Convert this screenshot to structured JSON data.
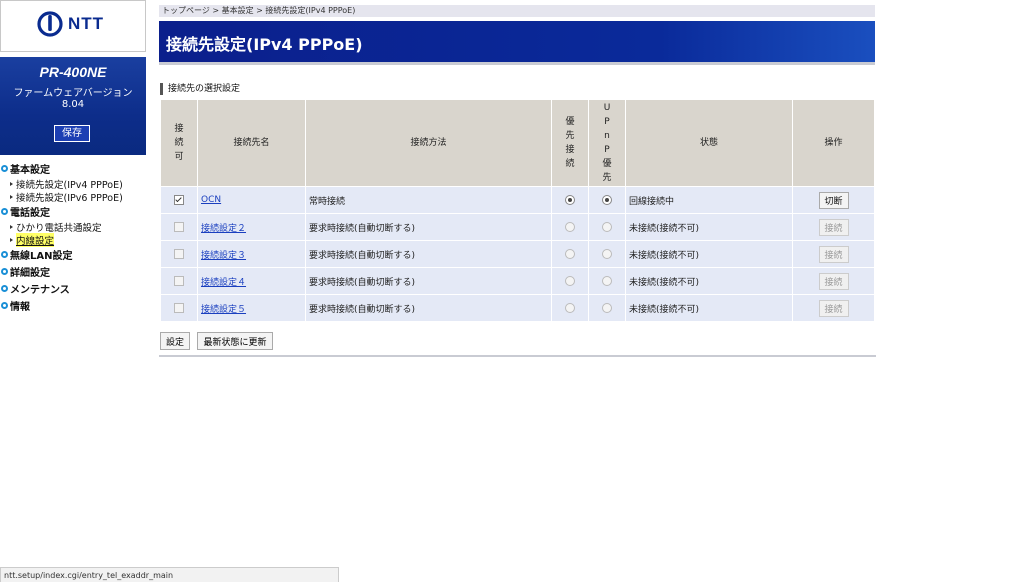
{
  "brand": {
    "logo_text": "NTT"
  },
  "device": {
    "model": "PR-400NE",
    "firmware_label": "ファームウェアバージョン",
    "firmware_version": "8.04",
    "save_label": "保存"
  },
  "nav": {
    "basic": {
      "label": "基本設定",
      "items": [
        "接続先設定(IPv4 PPPoE)",
        "接続先設定(IPv6 PPPoE)"
      ]
    },
    "phone": {
      "label": "電話設定",
      "items": [
        "ひかり電話共通設定",
        "内線設定"
      ]
    },
    "wireless": {
      "label": "無線LAN設定"
    },
    "advanced": {
      "label": "詳細設定"
    },
    "maintenance": {
      "label": "メンテナンス"
    },
    "info": {
      "label": "情報"
    }
  },
  "breadcrumb": "トップページ > 基本設定 > 接続先設定(IPv4 PPPoE)",
  "page": {
    "title": "接続先設定(IPv4 PPPoE)",
    "section_title": "接続先の選択設定"
  },
  "table": {
    "headers": {
      "enable": "接続可",
      "name": "接続先名",
      "method": "接続方法",
      "priority": "優先接続",
      "upnp": "UPnP優先",
      "status": "状態",
      "operation": "操作"
    },
    "rows": [
      {
        "enabled": true,
        "name": "OCN",
        "method": "常時接続",
        "priority": true,
        "upnp": true,
        "status": "回線接続中",
        "op": "切断",
        "op_enabled": true
      },
      {
        "enabled": false,
        "name": "接続設定２",
        "method": "要求時接続(自動切断する)",
        "priority": false,
        "upnp": false,
        "status": "未接続(接続不可)",
        "op": "接続",
        "op_enabled": false
      },
      {
        "enabled": false,
        "name": "接続設定３",
        "method": "要求時接続(自動切断する)",
        "priority": false,
        "upnp": false,
        "status": "未接続(接続不可)",
        "op": "接続",
        "op_enabled": false
      },
      {
        "enabled": false,
        "name": "接続設定４",
        "method": "要求時接続(自動切断する)",
        "priority": false,
        "upnp": false,
        "status": "未接続(接続不可)",
        "op": "接続",
        "op_enabled": false
      },
      {
        "enabled": false,
        "name": "接続設定５",
        "method": "要求時接続(自動切断する)",
        "priority": false,
        "upnp": false,
        "status": "未接続(接続不可)",
        "op": "接続",
        "op_enabled": false
      }
    ]
  },
  "actions": {
    "set_label": "設定",
    "refresh_label": "最新状態に更新"
  },
  "statusbar": {
    "url": "ntt.setup/index.cgi/entry_tel_exaddr_main"
  },
  "colors": {
    "header_blue": "#0b1f8c",
    "table_row": "#e4e9f6",
    "table_head": "#d9d5cd",
    "active_highlight": "#ffff66"
  }
}
